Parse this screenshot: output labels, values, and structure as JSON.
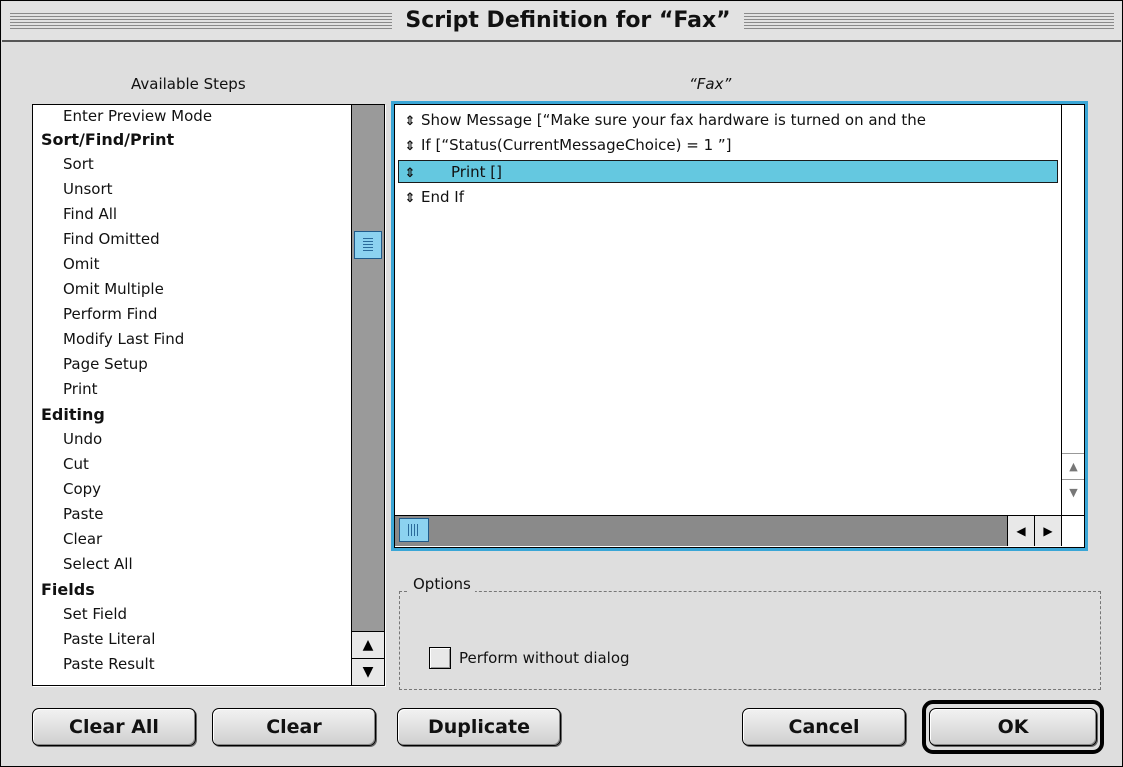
{
  "window": {
    "title": "Script Definition for “Fax”"
  },
  "available_steps": {
    "label": "Available Steps",
    "items": [
      {
        "text": "Enter Preview Mode",
        "category": false
      },
      {
        "text": "Sort/Find/Print",
        "category": true
      },
      {
        "text": "Sort",
        "category": false
      },
      {
        "text": "Unsort",
        "category": false
      },
      {
        "text": "Find All",
        "category": false
      },
      {
        "text": "Find Omitted",
        "category": false
      },
      {
        "text": "Omit",
        "category": false
      },
      {
        "text": "Omit Multiple",
        "category": false
      },
      {
        "text": "Perform Find",
        "category": false
      },
      {
        "text": "Modify Last Find",
        "category": false
      },
      {
        "text": "Page Setup",
        "category": false
      },
      {
        "text": "Print",
        "category": false
      },
      {
        "text": "Editing",
        "category": true
      },
      {
        "text": "Undo",
        "category": false
      },
      {
        "text": "Cut",
        "category": false
      },
      {
        "text": "Copy",
        "category": false
      },
      {
        "text": "Paste",
        "category": false
      },
      {
        "text": "Clear",
        "category": false
      },
      {
        "text": "Select All",
        "category": false
      },
      {
        "text": "Fields",
        "category": true
      },
      {
        "text": "Set Field",
        "category": false
      },
      {
        "text": "Paste Literal",
        "category": false
      },
      {
        "text": "Paste Result",
        "category": false
      }
    ]
  },
  "script": {
    "label": "“Fax”",
    "steps": [
      {
        "text": "Show Message [“Make sure your fax hardware is turned on and the",
        "indent": 0,
        "selected": false
      },
      {
        "text": "If [“Status(CurrentMessageChoice) = 1 ”]",
        "indent": 0,
        "selected": false
      },
      {
        "text": "Print []",
        "indent": 1,
        "selected": true
      },
      {
        "text": "End If",
        "indent": 0,
        "selected": false
      }
    ]
  },
  "options": {
    "legend": "Options",
    "perform_without_dialog": {
      "label": "Perform without dialog",
      "checked": false
    }
  },
  "buttons": {
    "clear_all": "Clear All",
    "clear": "Clear",
    "duplicate": "Duplicate",
    "cancel": "Cancel",
    "ok": "OK"
  },
  "colors": {
    "selection": "#64c8e0",
    "focus_ring": "#3aa6d6",
    "thumb": "#8cd2f0"
  }
}
